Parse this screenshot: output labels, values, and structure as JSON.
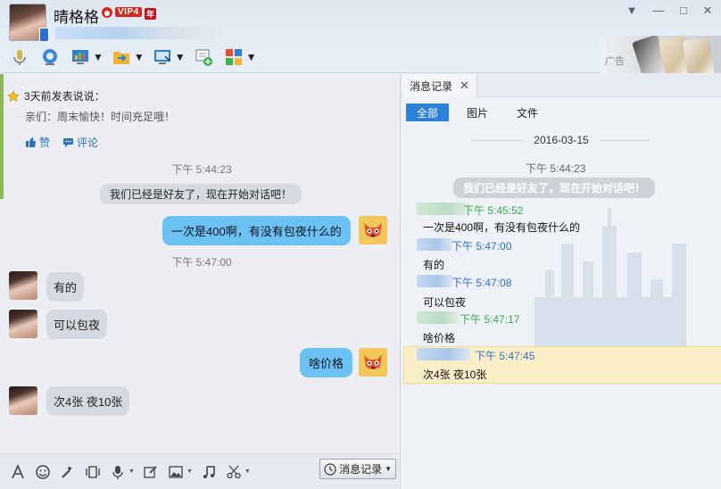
{
  "header": {
    "nickname": "晴格格",
    "vip_label": "VIP4",
    "vip_year": "年"
  },
  "window_controls": {
    "menu": "▼",
    "minimize": "—",
    "maximize": "□",
    "close": "✕"
  },
  "toolbar": {
    "items": [
      "microphone-icon",
      "camera-icon",
      "screen-share-icon",
      "file-transfer-icon",
      "remote-desktop-icon",
      "add-app-icon",
      "apps-icon"
    ]
  },
  "ad": {
    "label": "广告"
  },
  "feed": {
    "title": "3天前发表说说：",
    "content": "亲们：周末愉快！时间充足哦！",
    "like": "赞",
    "comment": "评论"
  },
  "chat": {
    "time1": "下午 5:44:23",
    "system": "我们已经是好友了，现在开始对话吧！",
    "msg_out1": "一次是400啊，有没有包夜什么的",
    "time2": "下午 5:47:00",
    "msg_in1": "有的",
    "msg_in2": "可以包夜",
    "msg_out2": "啥价格",
    "msg_in3": "次4张 夜10张"
  },
  "input_bar": {
    "history_button": "消息记录"
  },
  "history": {
    "tab_label": "消息记录",
    "tab_close": "✕",
    "filters": [
      "全部",
      "图片",
      "文件"
    ],
    "date": "2016-03-15",
    "time1": "下午 5:44:23",
    "system": "我们已经是好友了，现在开始对话吧！",
    "records": [
      {
        "time": "下午 5:45:52",
        "text": "一次是400啊，有没有包夜什么的"
      },
      {
        "time": "下午 5:47:00",
        "text": "有的"
      },
      {
        "time": "下午 5:47:08",
        "text": "可以包夜"
      },
      {
        "time": "下午 5:47:17",
        "text": "啥价格"
      },
      {
        "time": "下午 5:47:45",
        "text": "次4张 夜10张"
      }
    ]
  },
  "colors": {
    "bubble_out": "#6cc3f3",
    "bubble_in": "#d5d9e1",
    "active_filter": "#2b82d9",
    "link": "#2b6fc4",
    "own_time": "#38a84a",
    "peer_time": "#2d6fc7",
    "highlight": "#fbefc8"
  }
}
